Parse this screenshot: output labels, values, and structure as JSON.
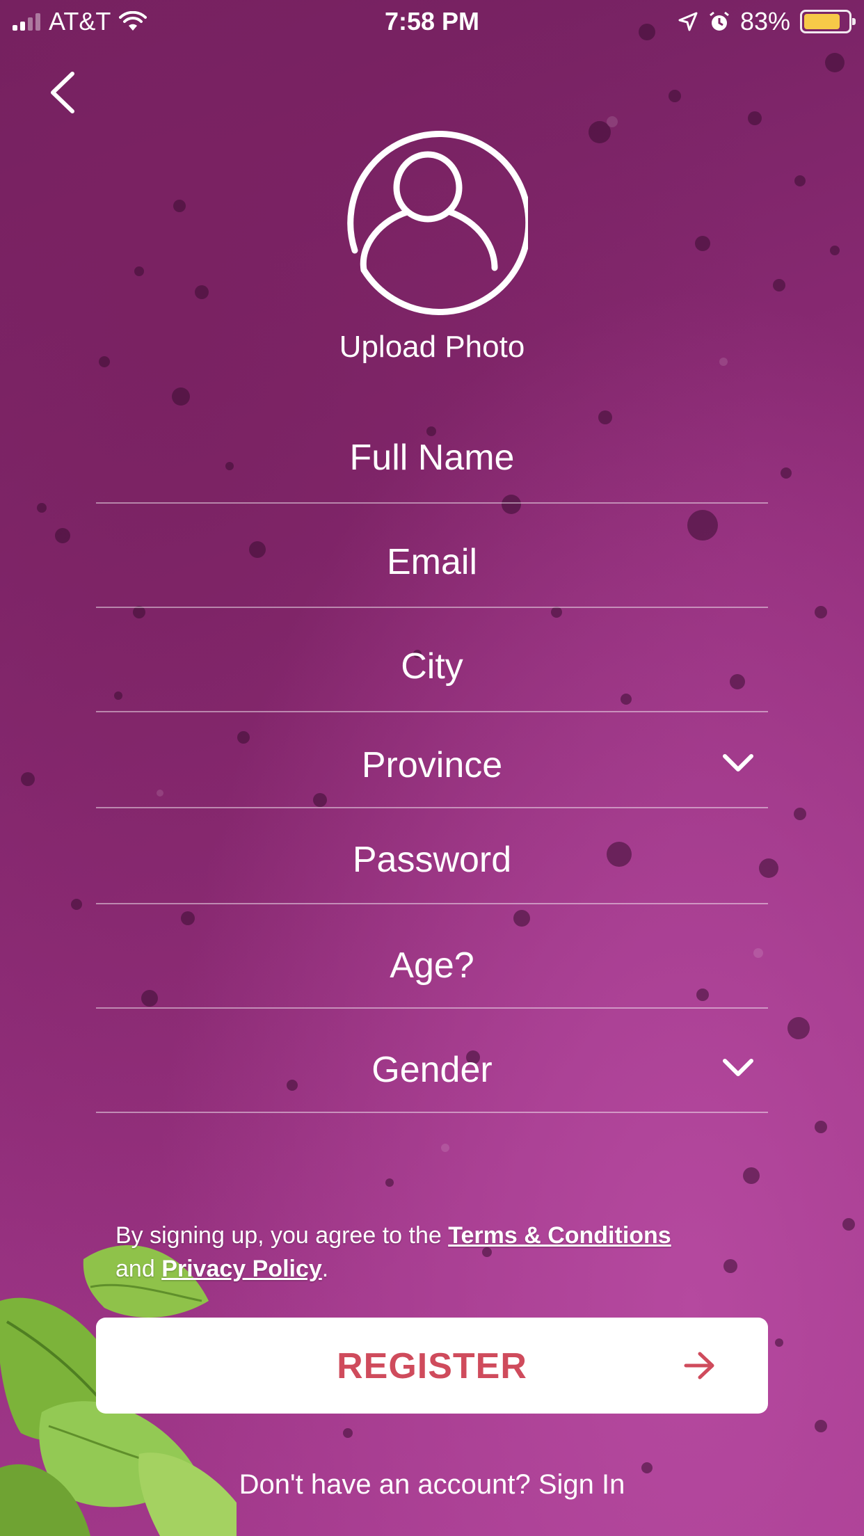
{
  "status_bar": {
    "carrier": "AT&T",
    "time": "7:58 PM",
    "battery_percent": "83%",
    "battery_level": 0.83,
    "battery_color": "#f7c948",
    "icons": [
      "signal-icon",
      "wifi-icon",
      "location-arrow-icon",
      "alarm-icon",
      "battery-icon"
    ]
  },
  "nav": {
    "back_icon": "chevron-left-icon"
  },
  "avatar": {
    "icon": "user-circle-icon",
    "upload_label": "Upload Photo"
  },
  "form": {
    "full_name": "Full Name",
    "email": "Email",
    "city": "City",
    "province": "Province",
    "password": "Password",
    "age": "Age?",
    "gender": "Gender",
    "dropdown_icon": "chevron-down-icon"
  },
  "terms": {
    "prefix": "By signing up, you agree to the ",
    "terms_link": "Terms & Conditions",
    "middle": "and ",
    "privacy_link": "Privacy Policy",
    "suffix": "."
  },
  "register": {
    "label": "REGISTER",
    "icon": "arrow-right-icon",
    "accent_color": "#cf4b5c"
  },
  "signin": {
    "text": "Don't have an account? Sign In"
  },
  "colors": {
    "background": "#8f2c78",
    "line": "rgba(255,255,255,0.45)"
  }
}
